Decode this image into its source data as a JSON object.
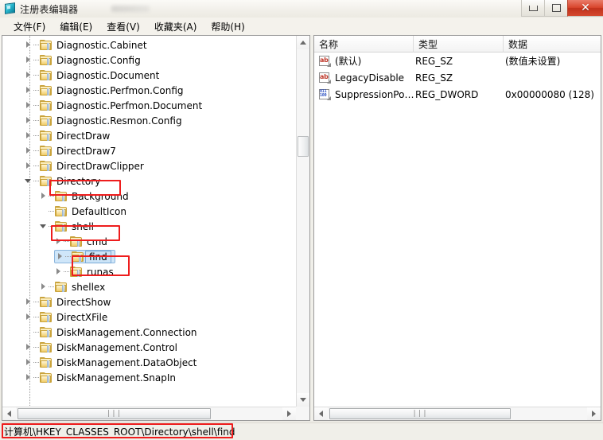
{
  "window": {
    "title": "注册表编辑器",
    "icon": "regedit-icon",
    "buttons": {
      "minimize": "最小化",
      "maximize": "最大化",
      "close": "关闭"
    }
  },
  "menu": {
    "items": [
      {
        "label": "文件(F)",
        "name": "menu-file"
      },
      {
        "label": "编辑(E)",
        "name": "menu-edit"
      },
      {
        "label": "查看(V)",
        "name": "menu-view"
      },
      {
        "label": "收藏夹(A)",
        "name": "menu-favorites"
      },
      {
        "label": "帮助(H)",
        "name": "menu-help"
      }
    ]
  },
  "tree": {
    "nodes": [
      {
        "label": "Diagnostic.Cabinet",
        "depth": 1,
        "state": "collapsed",
        "selected": false,
        "highlighted": false
      },
      {
        "label": "Diagnostic.Config",
        "depth": 1,
        "state": "collapsed",
        "selected": false,
        "highlighted": false
      },
      {
        "label": "Diagnostic.Document",
        "depth": 1,
        "state": "collapsed",
        "selected": false,
        "highlighted": false
      },
      {
        "label": "Diagnostic.Perfmon.Config",
        "depth": 1,
        "state": "collapsed",
        "selected": false,
        "highlighted": false
      },
      {
        "label": "Diagnostic.Perfmon.Document",
        "depth": 1,
        "state": "collapsed",
        "selected": false,
        "highlighted": false
      },
      {
        "label": "Diagnostic.Resmon.Config",
        "depth": 1,
        "state": "collapsed",
        "selected": false,
        "highlighted": false
      },
      {
        "label": "DirectDraw",
        "depth": 1,
        "state": "collapsed",
        "selected": false,
        "highlighted": false
      },
      {
        "label": "DirectDraw7",
        "depth": 1,
        "state": "collapsed",
        "selected": false,
        "highlighted": false
      },
      {
        "label": "DirectDrawClipper",
        "depth": 1,
        "state": "collapsed",
        "selected": false,
        "highlighted": false
      },
      {
        "label": "Directory",
        "depth": 1,
        "state": "expanded",
        "selected": false,
        "highlighted": true
      },
      {
        "label": "Background",
        "depth": 2,
        "state": "collapsed",
        "selected": false,
        "highlighted": false
      },
      {
        "label": "DefaultIcon",
        "depth": 2,
        "state": "leaf",
        "selected": false,
        "highlighted": false
      },
      {
        "label": "shell",
        "depth": 2,
        "state": "expanded",
        "selected": false,
        "highlighted": true
      },
      {
        "label": "cmd",
        "depth": 3,
        "state": "collapsed",
        "selected": false,
        "highlighted": false
      },
      {
        "label": "find",
        "depth": 3,
        "state": "collapsed",
        "selected": true,
        "highlighted": true
      },
      {
        "label": "runas",
        "depth": 3,
        "state": "collapsed",
        "selected": false,
        "highlighted": false
      },
      {
        "label": "shellex",
        "depth": 2,
        "state": "collapsed",
        "selected": false,
        "highlighted": false
      },
      {
        "label": "DirectShow",
        "depth": 1,
        "state": "collapsed",
        "selected": false,
        "highlighted": false
      },
      {
        "label": "DirectXFile",
        "depth": 1,
        "state": "collapsed",
        "selected": false,
        "highlighted": false
      },
      {
        "label": "DiskManagement.Connection",
        "depth": 1,
        "state": "leaf",
        "selected": false,
        "highlighted": false
      },
      {
        "label": "DiskManagement.Control",
        "depth": 1,
        "state": "collapsed",
        "selected": false,
        "highlighted": false
      },
      {
        "label": "DiskManagement.DataObject",
        "depth": 1,
        "state": "collapsed",
        "selected": false,
        "highlighted": false
      },
      {
        "label": "DiskManagement.SnapIn",
        "depth": 1,
        "state": "collapsed",
        "selected": false,
        "highlighted": false
      }
    ]
  },
  "values_list": {
    "columns": [
      {
        "label": "名称",
        "key": "name"
      },
      {
        "label": "类型",
        "key": "type"
      },
      {
        "label": "数据",
        "key": "data"
      }
    ],
    "rows": [
      {
        "name": "(默认)",
        "type": "REG_SZ",
        "data": "(数值未设置)",
        "icon": "string-value-icon"
      },
      {
        "name": "LegacyDisable",
        "type": "REG_SZ",
        "data": "",
        "icon": "string-value-icon"
      },
      {
        "name": "SuppressionPo…",
        "type": "REG_DWORD",
        "data": "0x00000080 (128)",
        "icon": "dword-value-icon"
      }
    ]
  },
  "scrollbars": {
    "tree_vertical_grip": "",
    "tree_horizontal_grip": "|||",
    "list_horizontal_grip": "|||"
  },
  "statusbar": {
    "path": "计算机\\HKEY_CLASSES_ROOT\\Directory\\shell\\find"
  },
  "annotation": {
    "color": "#ee1d1d"
  }
}
